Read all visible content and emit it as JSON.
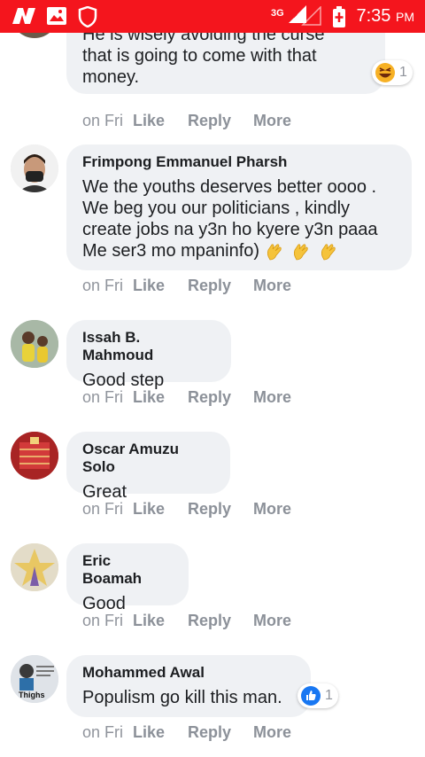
{
  "status_bar": {
    "network": "3G",
    "time": "7:35",
    "ampm": "PM"
  },
  "comments": [
    {
      "author": "",
      "text_lines": [
        "He is wisely avoiding the curse",
        "that is going to come with that",
        "money."
      ],
      "time": "on Fri",
      "like": "Like",
      "reply": "Reply",
      "more": "More",
      "reaction": "haha",
      "reaction_count": "1"
    },
    {
      "author": "Frimpong Emmanuel Pharsh",
      "text_lines": [
        "We the youths deserves better oooo .",
        "We beg you our politicians , kindly",
        "create jobs na y3n ho kyere y3n paaa",
        "Me ser3 mo mpaninfo)"
      ],
      "time": "on Fri",
      "like": "Like",
      "reply": "Reply",
      "more": "More"
    },
    {
      "author": "Issah B. Mahmoud",
      "text_lines": [
        "Good step"
      ],
      "time": "on Fri",
      "like": "Like",
      "reply": "Reply",
      "more": "More"
    },
    {
      "author": "Oscar Amuzu Solo",
      "text_lines": [
        "Great"
      ],
      "time": "on Fri",
      "like": "Like",
      "reply": "Reply",
      "more": "More"
    },
    {
      "author": "Eric Boamah",
      "text_lines": [
        "Good"
      ],
      "time": "on Fri",
      "like": "Like",
      "reply": "Reply",
      "more": "More"
    },
    {
      "author": "Mohammed Awal",
      "text_lines": [
        "Populism go kill this man."
      ],
      "time": "on Fri",
      "like": "Like",
      "reply": "Reply",
      "more": "More",
      "reaction": "like",
      "reaction_count": "1",
      "avatar_caption": "Thighs"
    }
  ],
  "colors": {
    "status_bar": "#f4151d",
    "bubble": "#eff1f4",
    "meta_text": "#90949c",
    "like_blue": "#1877f2"
  }
}
